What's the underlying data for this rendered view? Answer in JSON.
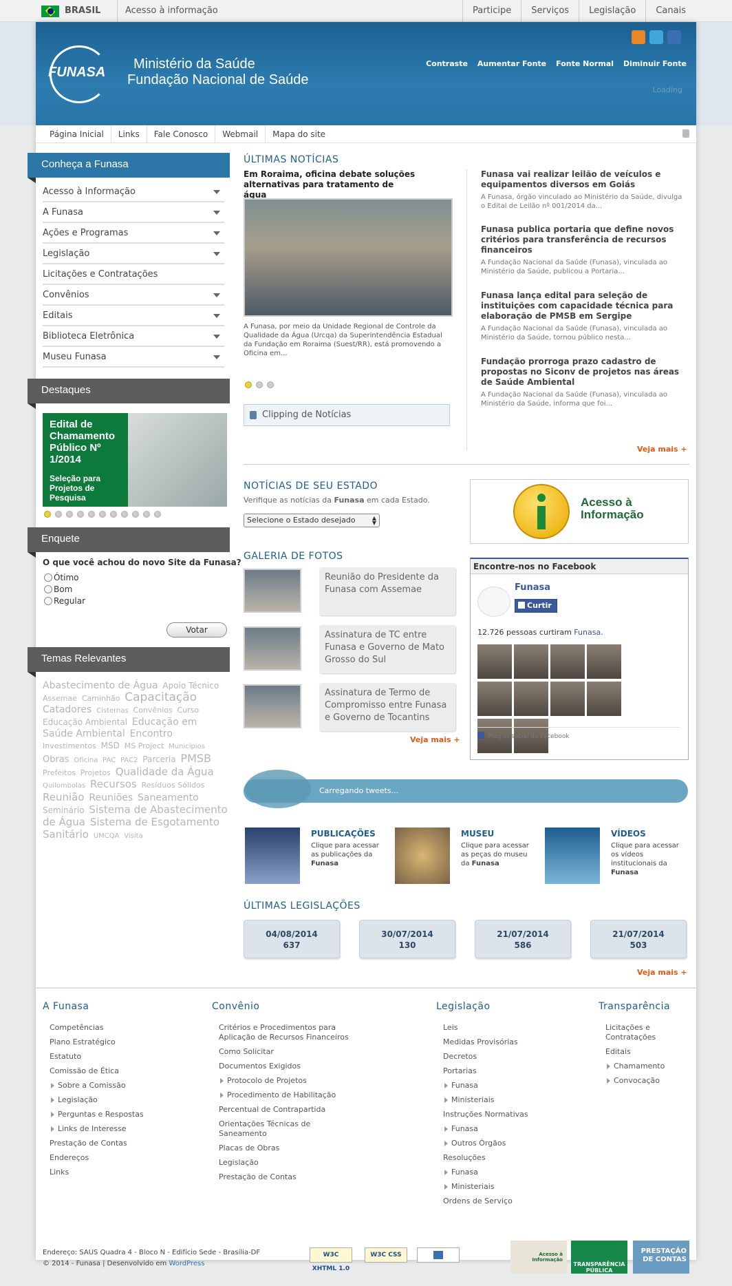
{
  "gov_bar": {
    "brasil": "BRASIL",
    "acesso": "Acesso à informação",
    "links": [
      "Participe",
      "Serviços",
      "Legislação",
      "Canais"
    ]
  },
  "header": {
    "logo_text": "FUNASA",
    "ministry": "Ministério da Saúde",
    "foundation": "Fundação Nacional de Saúde",
    "accessibility": [
      "Contraste",
      "Aumentar Fonte",
      "Fonte Normal",
      "Diminuir Fonte"
    ],
    "loading": "Loading",
    "social_icons": [
      "rss-icon",
      "twitter-icon",
      "facebook-icon"
    ]
  },
  "topnav": [
    "Página Inicial",
    "Links",
    "Fale Conosco",
    "Webmail",
    "Mapa do site"
  ],
  "sidebar": {
    "conheca_title": "Conheça a Funasa",
    "menu": [
      {
        "label": "Acesso à Informação",
        "arrow": true
      },
      {
        "label": "A Funasa",
        "arrow": true
      },
      {
        "label": "Ações e Programas",
        "arrow": true
      },
      {
        "label": "Legislação",
        "arrow": true
      },
      {
        "label": "Licitações e Contratações",
        "arrow": false
      },
      {
        "label": "Convênios",
        "arrow": true
      },
      {
        "label": "Editais",
        "arrow": true
      },
      {
        "label": "Biblioteca Eletrônica",
        "arrow": true
      },
      {
        "label": "Museu Funasa",
        "arrow": true
      }
    ],
    "destaques_title": "Destaques",
    "destaque": {
      "title": "Edital de Chamamento Público Nº 1/2014",
      "subtitle": "Seleção para Projetos de Pesquisa"
    },
    "destaque_dots": 11,
    "enquete_title": "Enquete",
    "enquete_question": "O que você achou do novo Site da Funasa?",
    "enquete_options": [
      "Ótimo",
      "Bom",
      "Regular"
    ],
    "vote_label": "Votar",
    "temas_title": "Temas Relevantes",
    "tags": [
      {
        "t": "Abastecimento de Água",
        "s": 14
      },
      {
        "t": "Apoio Técnico",
        "s": 12
      },
      {
        "t": "Assemae",
        "s": 11
      },
      {
        "t": "Caminhão",
        "s": 11
      },
      {
        "t": "Capacitação",
        "s": 17
      },
      {
        "t": "Catadores",
        "s": 14
      },
      {
        "t": "Cisternas",
        "s": 10
      },
      {
        "t": "Convênios",
        "s": 11
      },
      {
        "t": "Curso",
        "s": 11
      },
      {
        "t": "Educação Ambiental",
        "s": 12
      },
      {
        "t": "Educação em Saúde Ambiental",
        "s": 14
      },
      {
        "t": "Encontro",
        "s": 14
      },
      {
        "t": "Investimentos",
        "s": 11
      },
      {
        "t": "MSD",
        "s": 12
      },
      {
        "t": "MS Project",
        "s": 11
      },
      {
        "t": "Municípios",
        "s": 10
      },
      {
        "t": "Obras",
        "s": 13
      },
      {
        "t": "Oficina",
        "s": 10
      },
      {
        "t": "PAC",
        "s": 10
      },
      {
        "t": "PAC2",
        "s": 10
      },
      {
        "t": "Parceria",
        "s": 12
      },
      {
        "t": "PMSB",
        "s": 16
      },
      {
        "t": "Prefeitos",
        "s": 11
      },
      {
        "t": "Projetos",
        "s": 11
      },
      {
        "t": "Qualidade da Água",
        "s": 15
      },
      {
        "t": "Quilombolas",
        "s": 10
      },
      {
        "t": "Recursos",
        "s": 15
      },
      {
        "t": "Resíduos Sólidos",
        "s": 11
      },
      {
        "t": "Reunião",
        "s": 15
      },
      {
        "t": "Reuniões",
        "s": 14
      },
      {
        "t": "Saneamento",
        "s": 14
      },
      {
        "t": "Seminário",
        "s": 12
      },
      {
        "t": "Sistema de Abastecimento de Água",
        "s": 15
      },
      {
        "t": "Sistema de Esgotamento Sanitário",
        "s": 15
      },
      {
        "t": "UMCQA",
        "s": 10
      },
      {
        "t": "Visita",
        "s": 10
      }
    ]
  },
  "news": {
    "title": "ÚLTIMAS NOTÍCIAS",
    "lead_title": "Em Roraima, oficina debate soluções alternativas para tratamento de água",
    "lead_text": "A Funasa, por meio da Unidade Regional de Controle da Qualidade da Água (Urcqa) da Superintendência Estadual da Fundação em Roraima (Suest/RR), está promovendo a Oficina em...",
    "lead_dots": 3,
    "clipping": "Clipping de Notícias",
    "items": [
      {
        "title": "Funasa vai realizar leilão de veículos e equipamentos diversos em Goiás",
        "desc": "A Funasa, órgão vinculado ao Ministério da Saúde, divulga o Edital de Leilão nº 001/2014 da..."
      },
      {
        "title": "Funasa publica portaria que define novos critérios para transferência de recursos financeiros",
        "desc": "A Fundação Nacional da Saúde (Funasa), vinculada ao Ministério da Saúde, publicou a Portaria..."
      },
      {
        "title": "Funasa lança edital para seleção de instituições com capacidade técnica para elaboração de PMSB em Sergipe",
        "desc": "A Fundação Nacional da Saúde (Funasa), vinculada ao Ministério da Saúde, tornou público nesta..."
      },
      {
        "title": "Fundação prorroga prazo cadastro de propostas no Siconv de projetos nas áreas de Saúde Ambiental",
        "desc": "A Fundação Nacional da Saúde (Funasa), vinculada ao Ministério da Saúde, informa que foi..."
      }
    ],
    "veja_mais": "Veja mais +"
  },
  "state": {
    "title": "NOTÍCIAS DE SEU ESTADO",
    "sub_before": "Verifique as notícias da ",
    "sub_bold": "Funasa",
    "sub_after": " em cada Estado.",
    "select": "Selecione o Estado desejado"
  },
  "acesso_box": {
    "line1": "Acesso à",
    "line2": "Informação"
  },
  "gallery": {
    "title": "GALERIA DE FOTOS",
    "items": [
      "Reunião do Presidente da Funasa com Assemae",
      "Assinatura de TC entre Funasa e Governo de Mato Grosso do Sul",
      "Assinatura de Termo de Compromisso entre Funasa e Governo de Tocantins"
    ],
    "veja_mais": "Veja mais +"
  },
  "facebook": {
    "header": "Encontre-nos no Facebook",
    "page": "Funasa",
    "like": "Curtir",
    "count_before": "12.726 pessoas curtiram ",
    "count_link": "Funasa",
    "count_after": ".",
    "plugin": "Plug-in social do Facebook"
  },
  "twitter": {
    "text": "Carregando tweets..."
  },
  "features": [
    {
      "title": "PUBLICAÇÕES",
      "desc": "Clique para acessar as publicações da",
      "bold": "Funasa"
    },
    {
      "title": "MUSEU",
      "desc": "Clique para acessar as peças do museu da",
      "bold": "Funasa"
    },
    {
      "title": "VÍDEOS",
      "desc": "Clique para acessar os vídeos institucionais da",
      "bold": "Funasa"
    }
  ],
  "legislacoes": {
    "title": "ÚLTIMAS LEGISLAÇÕES",
    "items": [
      {
        "date": "04/08/2014",
        "num": "637"
      },
      {
        "date": "30/07/2014",
        "num": "130"
      },
      {
        "date": "21/07/2014",
        "num": "586"
      },
      {
        "date": "21/07/2014",
        "num": "503"
      }
    ],
    "veja_mais": "Veja mais +"
  },
  "footer": {
    "cols": [
      {
        "title": "A Funasa",
        "items": [
          {
            "t": "Competências"
          },
          {
            "t": "Plano Estratégico"
          },
          {
            "t": "Estatuto"
          },
          {
            "t": "Comissão de Ética"
          },
          {
            "t": "Sobre a Comissão",
            "sub": true
          },
          {
            "t": "Legislação",
            "sub": true
          },
          {
            "t": "Perguntas e Respostas",
            "sub": true
          },
          {
            "t": "Links de Interesse",
            "sub": true
          },
          {
            "t": "Prestação de Contas"
          },
          {
            "t": "Endereços"
          },
          {
            "t": "Links"
          }
        ]
      },
      {
        "title": "Convênio",
        "items": [
          {
            "t": "Critérios e Procedimentos para Aplicação de Recursos Financeiros"
          },
          {
            "t": "Como Solicitar"
          },
          {
            "t": "Documentos Exigidos"
          },
          {
            "t": "Protocolo de Projetos",
            "sub": true
          },
          {
            "t": "Procedimento de Habilitação",
            "sub": true
          },
          {
            "t": "Percentual de Contrapartida"
          },
          {
            "t": "Orientações Técnicas de Saneamento"
          },
          {
            "t": "Placas de Obras"
          },
          {
            "t": "Legislação"
          },
          {
            "t": "Prestação de Contas"
          }
        ]
      },
      {
        "title": "Legislação",
        "items": [
          {
            "t": "Leis"
          },
          {
            "t": "Medidas Provisórias"
          },
          {
            "t": "Decretos"
          },
          {
            "t": "Portarias"
          },
          {
            "t": "Funasa",
            "sub": true
          },
          {
            "t": "Ministeriais",
            "sub": true
          },
          {
            "t": "Instruções Normativas"
          },
          {
            "t": "Funasa",
            "sub": true
          },
          {
            "t": "Outros Órgãos",
            "sub": true
          },
          {
            "t": "Resoluções"
          },
          {
            "t": "Funasa",
            "sub": true
          },
          {
            "t": "Ministeriais",
            "sub": true
          },
          {
            "t": "Ordens de Serviço"
          }
        ]
      },
      {
        "title": "Transparência",
        "items": [
          {
            "t": "Licitações e Contratações"
          },
          {
            "t": "Editais"
          },
          {
            "t": "Chamamento",
            "sub": true
          },
          {
            "t": "Convocação",
            "sub": true
          }
        ]
      }
    ],
    "address": "Endereço: SAUS Quadra 4 - Bloco N - Edifício Sede - Brasília-DF",
    "copyright": "© 2014 - Funasa | Desenvolvido em ",
    "wordpress": "WordPress",
    "badges": [
      "W3C XHTML 1.0",
      "W3C CSS"
    ],
    "logos": [
      "Acesso à Informação",
      "TRANSPARÊNCIA PÚBLICA",
      "PRESTAÇÃO DE CONTAS"
    ]
  }
}
